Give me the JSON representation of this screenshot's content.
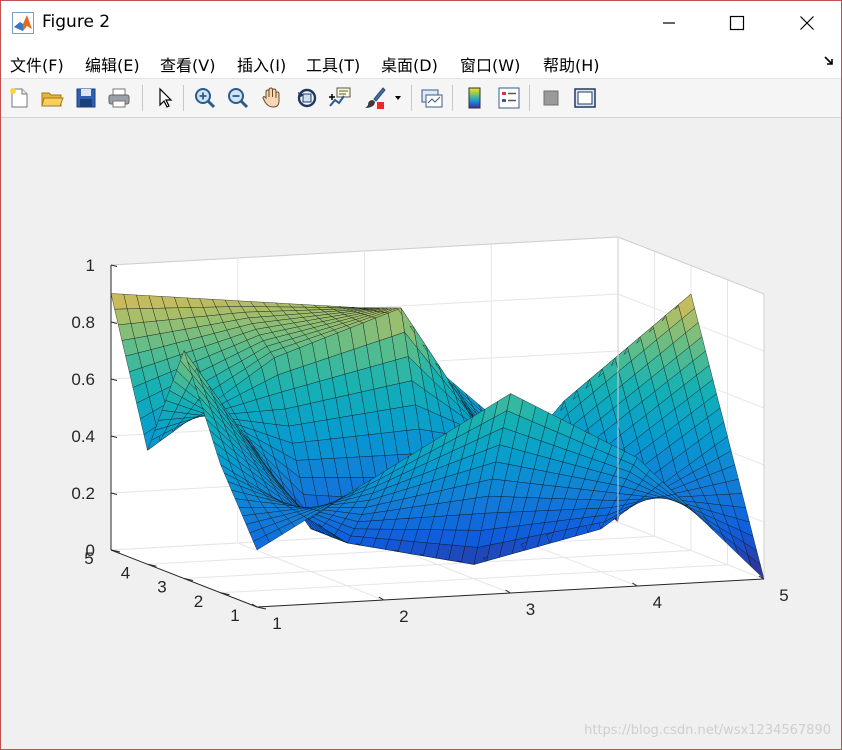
{
  "window": {
    "title": "Figure 2",
    "controls": {
      "minimize": "minimize",
      "maximize": "maximize",
      "close": "close"
    }
  },
  "menu": {
    "items": [
      "文件(F)",
      "编辑(E)",
      "查看(V)",
      "插入(I)",
      "工具(T)",
      "桌面(D)",
      "窗口(W)",
      "帮助(H)"
    ]
  },
  "toolbar": {
    "icons": [
      "new-figure-icon",
      "open-file-icon",
      "save-icon",
      "print-icon",
      "select-arrow-icon",
      "zoom-in-icon",
      "zoom-out-icon",
      "pan-hand-icon",
      "rotate-3d-icon",
      "data-cursor-icon",
      "brush-icon",
      "brush-dropdown-icon",
      "link-plot-icon",
      "colorbar-icon",
      "legend-icon",
      "hide-plot-tools-icon",
      "show-plot-tools-icon"
    ]
  },
  "plot": {
    "type": "surf",
    "colormap": "parula",
    "z_ticks": [
      "0",
      "0.2",
      "0.4",
      "0.6",
      "0.8",
      "1"
    ],
    "x_ticks": [
      "1",
      "2",
      "3",
      "4",
      "5"
    ],
    "y_ticks": [
      "1",
      "2",
      "3",
      "4",
      "5"
    ],
    "xlim": [
      1,
      5
    ],
    "ylim": [
      1,
      5
    ],
    "zlim": [
      0,
      1
    ],
    "grid": true,
    "box": true
  },
  "chart_data": {
    "type": "surface",
    "x": [
      1,
      2,
      3,
      4,
      5
    ],
    "y": [
      1,
      2,
      3,
      4,
      5
    ],
    "z": [
      [
        0.2,
        0.45,
        0.7,
        0.45,
        0.0
      ],
      [
        0.45,
        0.15,
        0.05,
        0.15,
        0.45
      ],
      [
        0.8,
        0.15,
        0.05,
        0.55,
        0.9
      ],
      [
        0.4,
        0.7,
        0.85,
        0.15,
        0.7
      ],
      [
        0.9,
        0.85,
        0.8,
        0.4,
        0.0
      ]
    ],
    "xlim": [
      1,
      5
    ],
    "ylim": [
      1,
      5
    ],
    "zlim": [
      0,
      1
    ],
    "x_ticks": [
      1,
      2,
      3,
      4,
      5
    ],
    "y_ticks": [
      1,
      2,
      3,
      4,
      5
    ],
    "z_ticks": [
      0,
      0.2,
      0.4,
      0.6,
      0.8,
      1
    ],
    "grid": true,
    "colormap": "parula",
    "title": "",
    "xlabel": "",
    "ylabel": "",
    "zlabel": ""
  },
  "watermark": "https://blog.csdn.net/wsx1234567890"
}
